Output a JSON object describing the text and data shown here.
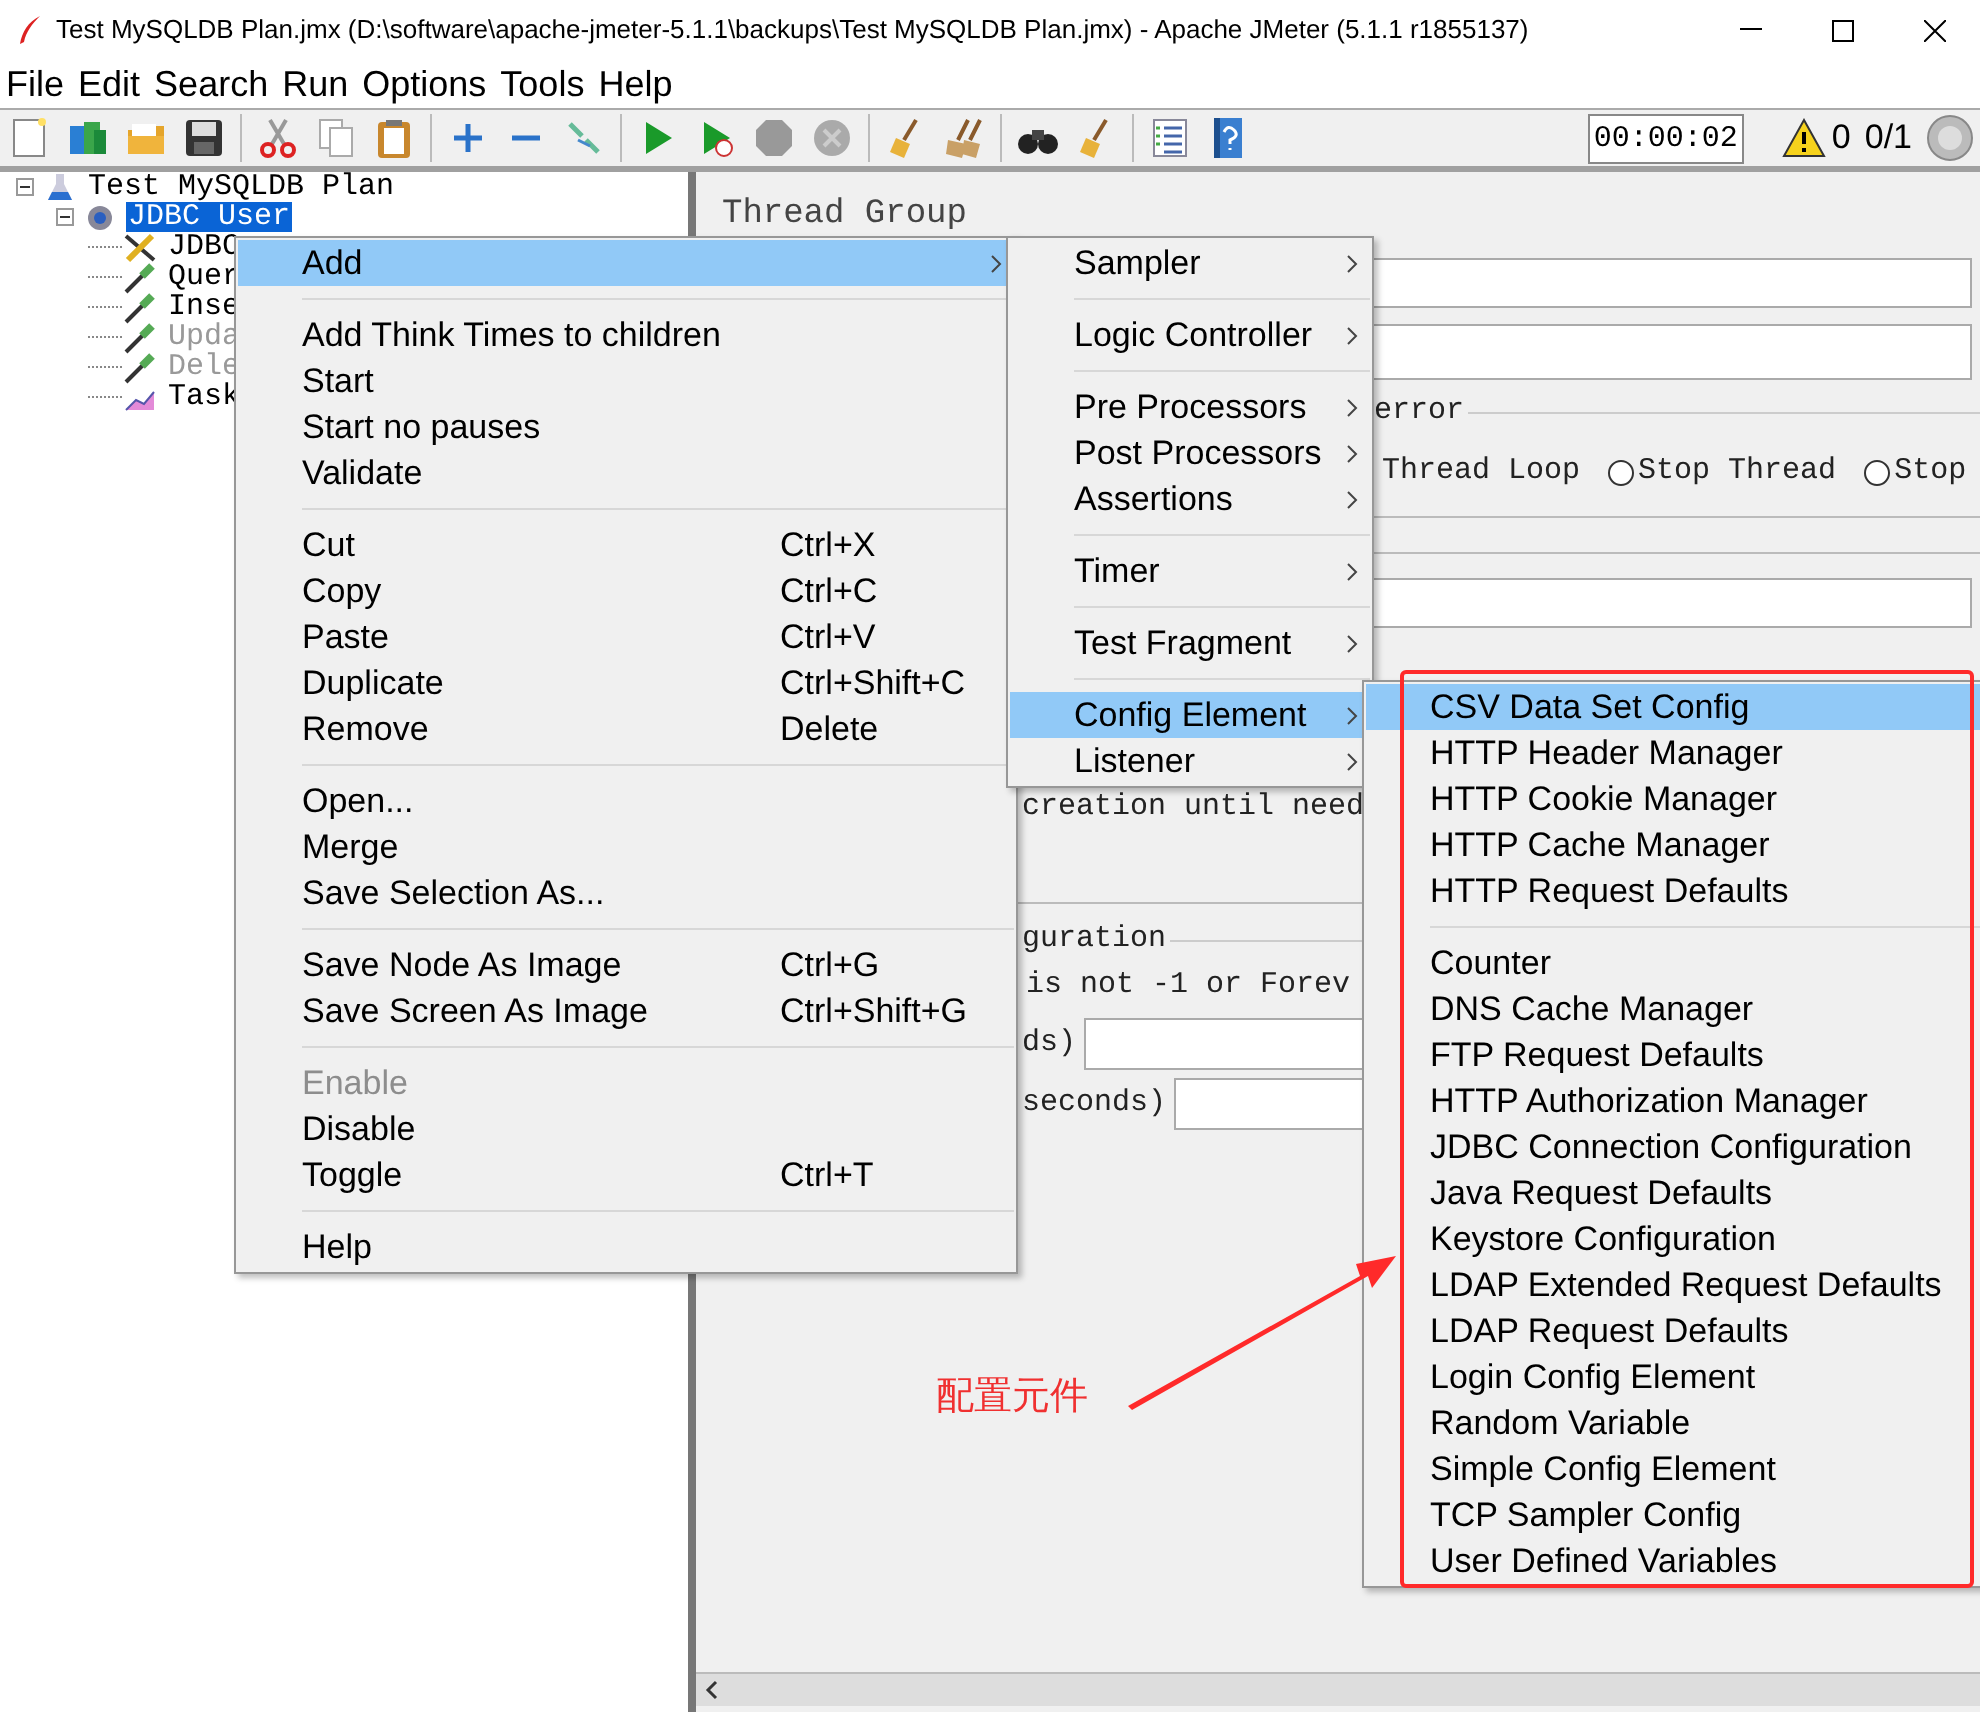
{
  "window": {
    "title": "Test MySQLDB Plan.jmx (D:\\software\\apache-jmeter-5.1.1\\backups\\Test MySQLDB Plan.jmx) - Apache JMeter (5.1.1 r1855137)"
  },
  "menu_bar": [
    "File",
    "Edit",
    "Search",
    "Run",
    "Options",
    "Tools",
    "Help"
  ],
  "toolbar": {
    "timer": "00:00:02",
    "warnings": "0",
    "threads": "0/1"
  },
  "tree": [
    {
      "label": "Test MySQLDB Plan",
      "kind": "plan",
      "expanded": true,
      "selected": false,
      "disabled": false,
      "children": [
        {
          "label": "JDBC User",
          "kind": "thread-group",
          "expanded": true,
          "selected": true,
          "disabled": false,
          "children": [
            {
              "label": "JDBC",
              "kind": "config",
              "selected": false,
              "disabled": false
            },
            {
              "label": "Quer",
              "kind": "sampler",
              "selected": false,
              "disabled": false
            },
            {
              "label": "Inse",
              "kind": "sampler",
              "selected": false,
              "disabled": false
            },
            {
              "label": "Upda",
              "kind": "sampler",
              "selected": false,
              "disabled": true
            },
            {
              "label": "Dele",
              "kind": "sampler",
              "selected": false,
              "disabled": true
            },
            {
              "label": "Task",
              "kind": "listener",
              "selected": false,
              "disabled": false
            }
          ]
        }
      ]
    }
  ],
  "panel": {
    "title": "Thread Group",
    "error_group": "error",
    "radio_options": [
      {
        "kind": "text",
        "label": "Thread Loop"
      },
      {
        "kind": "radio",
        "label": "Stop Thread",
        "selected": false
      },
      {
        "kind": "radio",
        "label": "Stop",
        "selected": false
      }
    ],
    "creation_text": "creation until need",
    "config_group": "guration",
    "loop_note": "is not -1 or Forev",
    "duration_label": "ds)",
    "delay_label": "seconds)"
  },
  "context_menu": [
    {
      "kind": "item",
      "label": "Add",
      "selected": true,
      "disabled": false,
      "has_submenu": true
    },
    {
      "kind": "separator"
    },
    {
      "kind": "item",
      "label": "Add Think Times to children",
      "selected": false,
      "disabled": false,
      "has_submenu": false
    },
    {
      "kind": "item",
      "label": "Start",
      "selected": false,
      "disabled": false,
      "has_submenu": false
    },
    {
      "kind": "item",
      "label": "Start no pauses",
      "selected": false,
      "disabled": false,
      "has_submenu": false
    },
    {
      "kind": "item",
      "label": "Validate",
      "selected": false,
      "disabled": false,
      "has_submenu": false
    },
    {
      "kind": "separator"
    },
    {
      "kind": "item",
      "label": "Cut",
      "shortcut": "Ctrl+X",
      "selected": false,
      "disabled": false,
      "has_submenu": false
    },
    {
      "kind": "item",
      "label": "Copy",
      "shortcut": "Ctrl+C",
      "selected": false,
      "disabled": false,
      "has_submenu": false
    },
    {
      "kind": "item",
      "label": "Paste",
      "shortcut": "Ctrl+V",
      "selected": false,
      "disabled": false,
      "has_submenu": false
    },
    {
      "kind": "item",
      "label": "Duplicate",
      "shortcut": "Ctrl+Shift+C",
      "selected": false,
      "disabled": false,
      "has_submenu": false
    },
    {
      "kind": "item",
      "label": "Remove",
      "shortcut": "Delete",
      "selected": false,
      "disabled": false,
      "has_submenu": false
    },
    {
      "kind": "separator"
    },
    {
      "kind": "item",
      "label": "Open...",
      "selected": false,
      "disabled": false,
      "has_submenu": false
    },
    {
      "kind": "item",
      "label": "Merge",
      "selected": false,
      "disabled": false,
      "has_submenu": false
    },
    {
      "kind": "item",
      "label": "Save Selection As...",
      "selected": false,
      "disabled": false,
      "has_submenu": false
    },
    {
      "kind": "separator"
    },
    {
      "kind": "item",
      "label": "Save Node As Image",
      "shortcut": "Ctrl+G",
      "selected": false,
      "disabled": false,
      "has_submenu": false
    },
    {
      "kind": "item",
      "label": "Save Screen As Image",
      "shortcut": "Ctrl+Shift+G",
      "selected": false,
      "disabled": false,
      "has_submenu": false
    },
    {
      "kind": "separator"
    },
    {
      "kind": "item",
      "label": "Enable",
      "selected": false,
      "disabled": true,
      "has_submenu": false
    },
    {
      "kind": "item",
      "label": "Disable",
      "selected": false,
      "disabled": false,
      "has_submenu": false
    },
    {
      "kind": "item",
      "label": "Toggle",
      "shortcut": "Ctrl+T",
      "selected": false,
      "disabled": false,
      "has_submenu": false
    },
    {
      "kind": "separator"
    },
    {
      "kind": "item",
      "label": "Help",
      "selected": false,
      "disabled": false,
      "has_submenu": false
    }
  ],
  "add_submenu": [
    {
      "kind": "item",
      "label": "Sampler",
      "selected": false,
      "has_submenu": true
    },
    {
      "kind": "separator"
    },
    {
      "kind": "item",
      "label": "Logic Controller",
      "selected": false,
      "has_submenu": true
    },
    {
      "kind": "separator"
    },
    {
      "kind": "item",
      "label": "Pre Processors",
      "selected": false,
      "has_submenu": true
    },
    {
      "kind": "item",
      "label": "Post Processors",
      "selected": false,
      "has_submenu": true
    },
    {
      "kind": "item",
      "label": "Assertions",
      "selected": false,
      "has_submenu": true
    },
    {
      "kind": "separator"
    },
    {
      "kind": "item",
      "label": "Timer",
      "selected": false,
      "has_submenu": true
    },
    {
      "kind": "separator"
    },
    {
      "kind": "item",
      "label": "Test Fragment",
      "selected": false,
      "has_submenu": true
    },
    {
      "kind": "separator"
    },
    {
      "kind": "item",
      "label": "Config Element",
      "selected": true,
      "has_submenu": true
    },
    {
      "kind": "item",
      "label": "Listener",
      "selected": false,
      "has_submenu": true
    }
  ],
  "config_submenu": [
    {
      "kind": "item",
      "label": "CSV Data Set Config",
      "selected": true
    },
    {
      "kind": "item",
      "label": "HTTP Header Manager",
      "selected": false
    },
    {
      "kind": "item",
      "label": "HTTP Cookie Manager",
      "selected": false
    },
    {
      "kind": "item",
      "label": "HTTP Cache Manager",
      "selected": false
    },
    {
      "kind": "item",
      "label": "HTTP Request Defaults",
      "selected": false
    },
    {
      "kind": "separator"
    },
    {
      "kind": "item",
      "label": "Counter",
      "selected": false
    },
    {
      "kind": "item",
      "label": "DNS Cache Manager",
      "selected": false
    },
    {
      "kind": "item",
      "label": "FTP Request Defaults",
      "selected": false
    },
    {
      "kind": "item",
      "label": "HTTP Authorization Manager",
      "selected": false
    },
    {
      "kind": "item",
      "label": "JDBC Connection Configuration",
      "selected": false
    },
    {
      "kind": "item",
      "label": "Java Request Defaults",
      "selected": false
    },
    {
      "kind": "item",
      "label": "Keystore Configuration",
      "selected": false
    },
    {
      "kind": "item",
      "label": "LDAP Extended Request Defaults",
      "selected": false
    },
    {
      "kind": "item",
      "label": "LDAP Request Defaults",
      "selected": false
    },
    {
      "kind": "item",
      "label": "Login Config Element",
      "selected": false
    },
    {
      "kind": "item",
      "label": "Random Variable",
      "selected": false
    },
    {
      "kind": "item",
      "label": "Simple Config Element",
      "selected": false
    },
    {
      "kind": "item",
      "label": "TCP Sampler Config",
      "selected": false
    },
    {
      "kind": "item",
      "label": "User Defined Variables",
      "selected": false
    }
  ],
  "annotation": {
    "label": "配置元件"
  }
}
